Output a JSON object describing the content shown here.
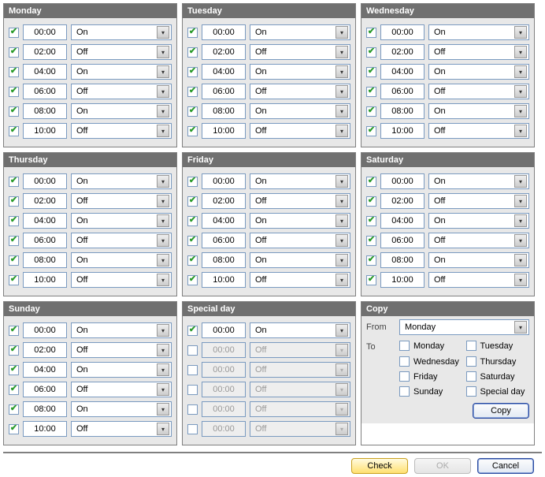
{
  "days": [
    {
      "name": "Monday",
      "rows": [
        {
          "checked": true,
          "time": "00:00",
          "state": "On",
          "disabled": false
        },
        {
          "checked": true,
          "time": "02:00",
          "state": "Off",
          "disabled": false
        },
        {
          "checked": true,
          "time": "04:00",
          "state": "On",
          "disabled": false
        },
        {
          "checked": true,
          "time": "06:00",
          "state": "Off",
          "disabled": false
        },
        {
          "checked": true,
          "time": "08:00",
          "state": "On",
          "disabled": false
        },
        {
          "checked": true,
          "time": "10:00",
          "state": "Off",
          "disabled": false
        }
      ]
    },
    {
      "name": "Tuesday",
      "rows": [
        {
          "checked": true,
          "time": "00:00",
          "state": "On",
          "disabled": false
        },
        {
          "checked": true,
          "time": "02:00",
          "state": "Off",
          "disabled": false
        },
        {
          "checked": true,
          "time": "04:00",
          "state": "On",
          "disabled": false
        },
        {
          "checked": true,
          "time": "06:00",
          "state": "Off",
          "disabled": false
        },
        {
          "checked": true,
          "time": "08:00",
          "state": "On",
          "disabled": false
        },
        {
          "checked": true,
          "time": "10:00",
          "state": "Off",
          "disabled": false
        }
      ]
    },
    {
      "name": "Wednesday",
      "rows": [
        {
          "checked": true,
          "time": "00:00",
          "state": "On",
          "disabled": false
        },
        {
          "checked": true,
          "time": "02:00",
          "state": "Off",
          "disabled": false
        },
        {
          "checked": true,
          "time": "04:00",
          "state": "On",
          "disabled": false
        },
        {
          "checked": true,
          "time": "06:00",
          "state": "Off",
          "disabled": false
        },
        {
          "checked": true,
          "time": "08:00",
          "state": "On",
          "disabled": false
        },
        {
          "checked": true,
          "time": "10:00",
          "state": "Off",
          "disabled": false
        }
      ]
    },
    {
      "name": "Thursday",
      "rows": [
        {
          "checked": true,
          "time": "00:00",
          "state": "On",
          "disabled": false
        },
        {
          "checked": true,
          "time": "02:00",
          "state": "Off",
          "disabled": false
        },
        {
          "checked": true,
          "time": "04:00",
          "state": "On",
          "disabled": false
        },
        {
          "checked": true,
          "time": "06:00",
          "state": "Off",
          "disabled": false
        },
        {
          "checked": true,
          "time": "08:00",
          "state": "On",
          "disabled": false
        },
        {
          "checked": true,
          "time": "10:00",
          "state": "Off",
          "disabled": false
        }
      ]
    },
    {
      "name": "Friday",
      "rows": [
        {
          "checked": true,
          "time": "00:00",
          "state": "On",
          "disabled": false
        },
        {
          "checked": true,
          "time": "02:00",
          "state": "Off",
          "disabled": false
        },
        {
          "checked": true,
          "time": "04:00",
          "state": "On",
          "disabled": false
        },
        {
          "checked": true,
          "time": "06:00",
          "state": "Off",
          "disabled": false
        },
        {
          "checked": true,
          "time": "08:00",
          "state": "On",
          "disabled": false
        },
        {
          "checked": true,
          "time": "10:00",
          "state": "Off",
          "disabled": false
        }
      ]
    },
    {
      "name": "Saturday",
      "rows": [
        {
          "checked": true,
          "time": "00:00",
          "state": "On",
          "disabled": false
        },
        {
          "checked": true,
          "time": "02:00",
          "state": "Off",
          "disabled": false
        },
        {
          "checked": true,
          "time": "04:00",
          "state": "On",
          "disabled": false
        },
        {
          "checked": true,
          "time": "06:00",
          "state": "Off",
          "disabled": false
        },
        {
          "checked": true,
          "time": "08:00",
          "state": "On",
          "disabled": false
        },
        {
          "checked": true,
          "time": "10:00",
          "state": "Off",
          "disabled": false
        }
      ]
    },
    {
      "name": "Sunday",
      "rows": [
        {
          "checked": true,
          "time": "00:00",
          "state": "On",
          "disabled": false
        },
        {
          "checked": true,
          "time": "02:00",
          "state": "Off",
          "disabled": false
        },
        {
          "checked": true,
          "time": "04:00",
          "state": "On",
          "disabled": false
        },
        {
          "checked": true,
          "time": "06:00",
          "state": "Off",
          "disabled": false
        },
        {
          "checked": true,
          "time": "08:00",
          "state": "On",
          "disabled": false
        },
        {
          "checked": true,
          "time": "10:00",
          "state": "Off",
          "disabled": false
        }
      ]
    },
    {
      "name": "Special day",
      "rows": [
        {
          "checked": true,
          "time": "00:00",
          "state": "On",
          "disabled": false
        },
        {
          "checked": false,
          "time": "00:00",
          "state": "Off",
          "disabled": true
        },
        {
          "checked": false,
          "time": "00:00",
          "state": "Off",
          "disabled": true
        },
        {
          "checked": false,
          "time": "00:00",
          "state": "Off",
          "disabled": true
        },
        {
          "checked": false,
          "time": "00:00",
          "state": "Off",
          "disabled": true
        },
        {
          "checked": false,
          "time": "00:00",
          "state": "Off",
          "disabled": true
        }
      ]
    }
  ],
  "copy": {
    "title": "Copy",
    "from_label": "From",
    "to_label": "To",
    "from_value": "Monday",
    "targets": [
      "Monday",
      "Tuesday",
      "Wednesday",
      "Thursday",
      "Friday",
      "Saturday",
      "Sunday",
      "Special day"
    ],
    "button": "Copy"
  },
  "footer": {
    "check": "Check",
    "ok": "OK",
    "cancel": "Cancel"
  }
}
